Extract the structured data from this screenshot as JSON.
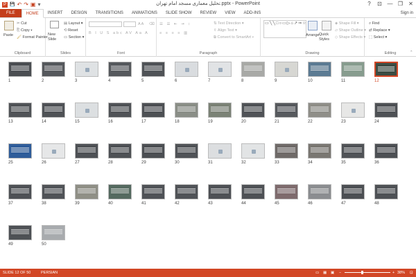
{
  "window": {
    "title": "تحلیل معماری مسجد امام تهران.pptx - PowerPoint",
    "minimize": "—",
    "restore": "❐",
    "close": "✕"
  },
  "qat": {
    "save": "💾",
    "undo": "↶",
    "redo": "↷",
    "present": "▣",
    "customize": "▾"
  },
  "tabs": [
    "FILE",
    "HOME",
    "INSERT",
    "DESIGN",
    "TRANSITIONS",
    "ANIMATIONS",
    "SLIDE SHOW",
    "REVIEW",
    "VIEW",
    "ADD-INS"
  ],
  "active_tab": "HOME",
  "sign_in": "Sign in",
  "ribbon": {
    "clipboard": {
      "paste": "Paste",
      "cut": "Cut",
      "copy": "Copy",
      "format_painter": "Format Painter",
      "label": "Clipboard"
    },
    "slides": {
      "new_slide": "New Slide",
      "layout": "Layout",
      "reset": "Reset",
      "section": "Section",
      "label": "Slides"
    },
    "font": {
      "label": "Font",
      "font_name": "",
      "font_size": ""
    },
    "paragraph": {
      "text_direction": "Text Direction",
      "align_text": "Align Text",
      "convert_smartart": "Convert to SmartArt",
      "label": "Paragraph"
    },
    "drawing": {
      "shapes_glyphs": "▭╲╲□○▭▷⌂↗⇒☆{}",
      "arrange": "Arrange",
      "quick_styles": "Quick Styles",
      "shape_fill": "Shape Fill",
      "shape_outline": "Shape Outline",
      "shape_effects": "Shape Effects",
      "label": "Drawing"
    },
    "editing": {
      "find": "Find",
      "replace": "Replace",
      "select": "Select",
      "label": "Editing"
    }
  },
  "slides": [
    {
      "n": "1",
      "bg": "#4b4e52"
    },
    {
      "n": "2",
      "bg": "#55585c"
    },
    {
      "n": "3",
      "bg": "#dfe2e4"
    },
    {
      "n": "4",
      "bg": "#56595d"
    },
    {
      "n": "5",
      "bg": "#505357"
    },
    {
      "n": "6",
      "bg": "#d9dcdf"
    },
    {
      "n": "7",
      "bg": "#e1e3e5"
    },
    {
      "n": "8",
      "bg": "#a8a9a6"
    },
    {
      "n": "9",
      "bg": "#d7d7d3"
    },
    {
      "n": "10",
      "bg": "#5c7b93"
    },
    {
      "n": "11",
      "bg": "#879c8e"
    },
    {
      "n": "12",
      "bg": "#3b4c43"
    },
    {
      "n": "13",
      "bg": "#505357"
    },
    {
      "n": "14",
      "bg": "#4f5256"
    },
    {
      "n": "15",
      "bg": "#dcdfe1"
    },
    {
      "n": "16",
      "bg": "#505357"
    },
    {
      "n": "17",
      "bg": "#4d5054"
    },
    {
      "n": "18",
      "bg": "#8a8e87"
    },
    {
      "n": "19",
      "bg": "#7b8276"
    },
    {
      "n": "20",
      "bg": "#505357"
    },
    {
      "n": "21",
      "bg": "#575a5e"
    },
    {
      "n": "22",
      "bg": "#8f8e88"
    },
    {
      "n": "23",
      "bg": "#e7e7e6"
    },
    {
      "n": "24",
      "bg": "#4e5155"
    },
    {
      "n": "25",
      "bg": "#2f5d9a"
    },
    {
      "n": "26",
      "bg": "#e6e7e8"
    },
    {
      "n": "27",
      "bg": "#4e5155"
    },
    {
      "n": "28",
      "bg": "#4e5155"
    },
    {
      "n": "29",
      "bg": "#4c4f53"
    },
    {
      "n": "30",
      "bg": "#505357"
    },
    {
      "n": "31",
      "bg": "#dcdee0"
    },
    {
      "n": "32",
      "bg": "#e2e4e5"
    },
    {
      "n": "33",
      "bg": "#6f6a68"
    },
    {
      "n": "34",
      "bg": "#7a7772"
    },
    {
      "n": "35",
      "bg": "#505357"
    },
    {
      "n": "36",
      "bg": "#4d5054"
    },
    {
      "n": "37",
      "bg": "#4e5155"
    },
    {
      "n": "38",
      "bg": "#505357"
    },
    {
      "n": "39",
      "bg": "#8f8f86"
    },
    {
      "n": "40",
      "bg": "#556a60"
    },
    {
      "n": "41",
      "bg": "#4f5256"
    },
    {
      "n": "42",
      "bg": "#505357"
    },
    {
      "n": "43",
      "bg": "#4e5155"
    },
    {
      "n": "44",
      "bg": "#4e5155"
    },
    {
      "n": "45",
      "bg": "#7e6b6d"
    },
    {
      "n": "46",
      "bg": "#8b8d90"
    },
    {
      "n": "47",
      "bg": "#4c4f53"
    },
    {
      "n": "48",
      "bg": "#4e5155"
    },
    {
      "n": "49",
      "bg": "#4e5155"
    },
    {
      "n": "50",
      "bg": "#a8abae"
    }
  ],
  "selected_slide": "12",
  "status": {
    "slide": "SLIDE 12 OF 50",
    "language": "PERSIAN",
    "zoom": "38%",
    "zoom_value": 0.38
  },
  "colors": {
    "accent": "#d24726",
    "file_tab": "#c43e1c"
  }
}
